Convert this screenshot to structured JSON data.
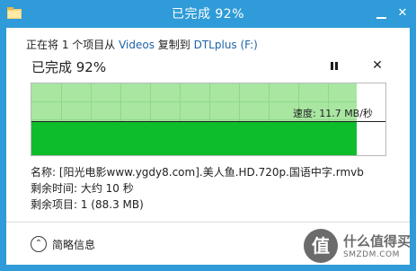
{
  "window": {
    "title": "已完成 92%",
    "minimize_symbol": "",
    "close_symbol": "✕"
  },
  "copy": {
    "prefix": "正在将 1 个项目从 ",
    "source": "Videos",
    "middle": " 复制到 ",
    "destination": "DTLplus (F:)"
  },
  "progress": {
    "heading": "已完成 92%",
    "percent": 92,
    "close_symbol": "✕"
  },
  "graph": {
    "speed_label": "速度: 11.7 MB/秒"
  },
  "details": {
    "name": "名称: [阳光电影www.ygdy8.com].美人鱼.HD.720p.国语中字.rmvb",
    "time_remaining": "剩余时间: 大约 10 秒",
    "items_remaining": "剩余项目: 1 (88.3 MB)"
  },
  "footer": {
    "toggle_symbol": "⌃",
    "toggle_label": "简略信息"
  },
  "watermark": {
    "logo_char": "值",
    "line1": "什么值得买",
    "line2": "SMZDM.COM"
  },
  "colors": {
    "accent": "#2f9bd8",
    "graph_light": "#a8e6a1",
    "graph_dark": "#0ebd2b",
    "link": "#1e63a8"
  }
}
